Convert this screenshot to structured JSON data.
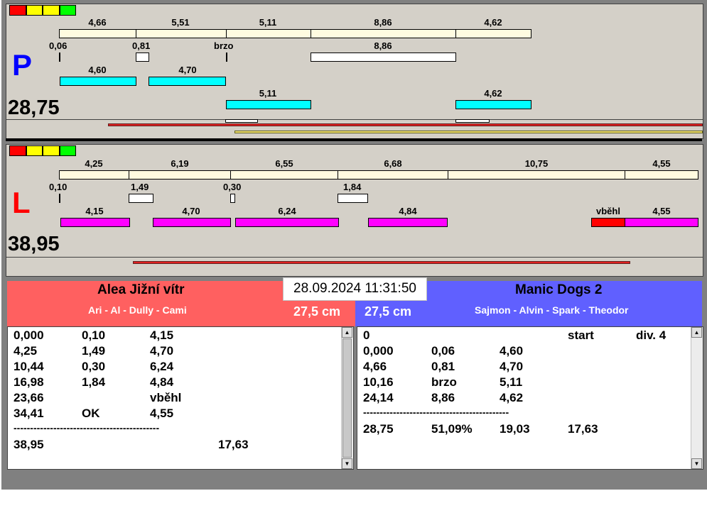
{
  "colors": {
    "background": "#808080",
    "lane": "#d4d0c8",
    "cream_bar": "#fffbe0",
    "cyan_bar": "#00ffff",
    "magenta_bar": "#ff00ff",
    "red_line": "#e02020",
    "yellow_line": "#f0e070",
    "left_team": "#ff6060",
    "right_team": "#6060ff",
    "lane_P_letter": "#0000ff",
    "lane_L_letter": "#ff0000",
    "lights": [
      "#ff0000",
      "#ffff00",
      "#ffff00",
      "#00ff00"
    ]
  },
  "lane_p": {
    "letter": "P",
    "total": "28,75",
    "row1": [
      "4,66",
      "5,51",
      "5,11",
      "8,86",
      "4,62"
    ],
    "row2": [
      "0,06",
      "0,81",
      "brzo",
      "8,86"
    ],
    "row3": [
      "4,60",
      "4,70"
    ],
    "row4": [
      "5,11",
      "4,62"
    ]
  },
  "lane_l": {
    "letter": "L",
    "total": "38,95",
    "row1": [
      "4,25",
      "6,19",
      "6,55",
      "6,68",
      "10,75",
      "4,55"
    ],
    "row2": [
      "0,10",
      "1,49",
      "0,30",
      "1,84"
    ],
    "row3": [
      "4,15",
      "4,70",
      "6,24",
      "4,84",
      "vběhl",
      "4,55"
    ]
  },
  "datetime": "28.09.2024 11:31:50",
  "left_team": {
    "name": "Alea Jižní vítr",
    "dogs": "Ari - Al - Dully - Cami",
    "height": "27,5 cm"
  },
  "right_team": {
    "name": "Manic Dogs 2",
    "dogs": "Sajmon - Alvin - Spark - Theodor",
    "height": "27,5 cm"
  },
  "left_log": {
    "rows": [
      [
        "0,000",
        "0,10",
        "4,15"
      ],
      [
        "4,25",
        "1,49",
        "4,70"
      ],
      [
        "10,44",
        "0,30",
        "6,24"
      ],
      [
        "16,98",
        "1,84",
        "4,84"
      ],
      [
        "23,66",
        "",
        "vběhl"
      ],
      [
        "34,41",
        "OK",
        "4,55"
      ]
    ],
    "separator": "--------------------------------------------",
    "total_time": "38,95",
    "total_extra": "17,63"
  },
  "right_log": {
    "header": [
      "0",
      "start",
      "div. 4"
    ],
    "rows": [
      [
        "0,000",
        "0,06",
        "4,60"
      ],
      [
        "4,66",
        "0,81",
        "4,70"
      ],
      [
        "10,16",
        "brzo",
        "5,11"
      ],
      [
        "24,14",
        "8,86",
        "4,62"
      ]
    ],
    "separator": "--------------------------------------------",
    "summary": [
      "28,75",
      "51,09%",
      "19,03",
      "17,63"
    ]
  }
}
